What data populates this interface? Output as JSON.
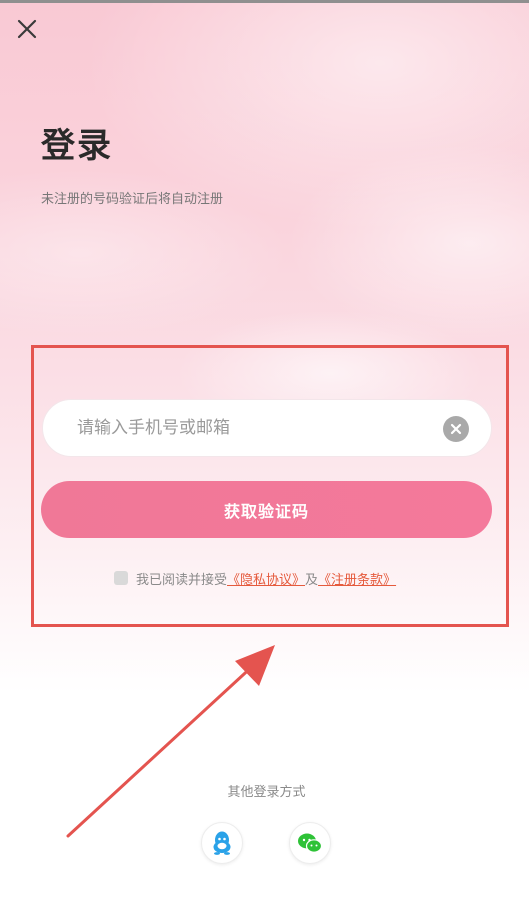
{
  "header": {
    "close_icon": "close-icon",
    "title": "登录",
    "subtitle": "未注册的号码验证后将自动注册"
  },
  "form": {
    "phone_input": {
      "value": "",
      "placeholder": "请输入手机号或邮箱"
    },
    "clear_icon": "clear-icon",
    "get_code_label": "获取验证码",
    "agreement": {
      "checked": false,
      "prefix": "我已阅读并接受",
      "privacy_link": "《隐私协议》",
      "conjunction": "及",
      "terms_link": "《注册条款》"
    }
  },
  "other_login": {
    "label": "其他登录方式",
    "methods": [
      {
        "icon": "qq-icon"
      },
      {
        "icon": "wechat-icon"
      }
    ]
  },
  "colors": {
    "accent": "#f4799b",
    "link": "#e55a3c",
    "highlight_frame": "#e4544f"
  }
}
